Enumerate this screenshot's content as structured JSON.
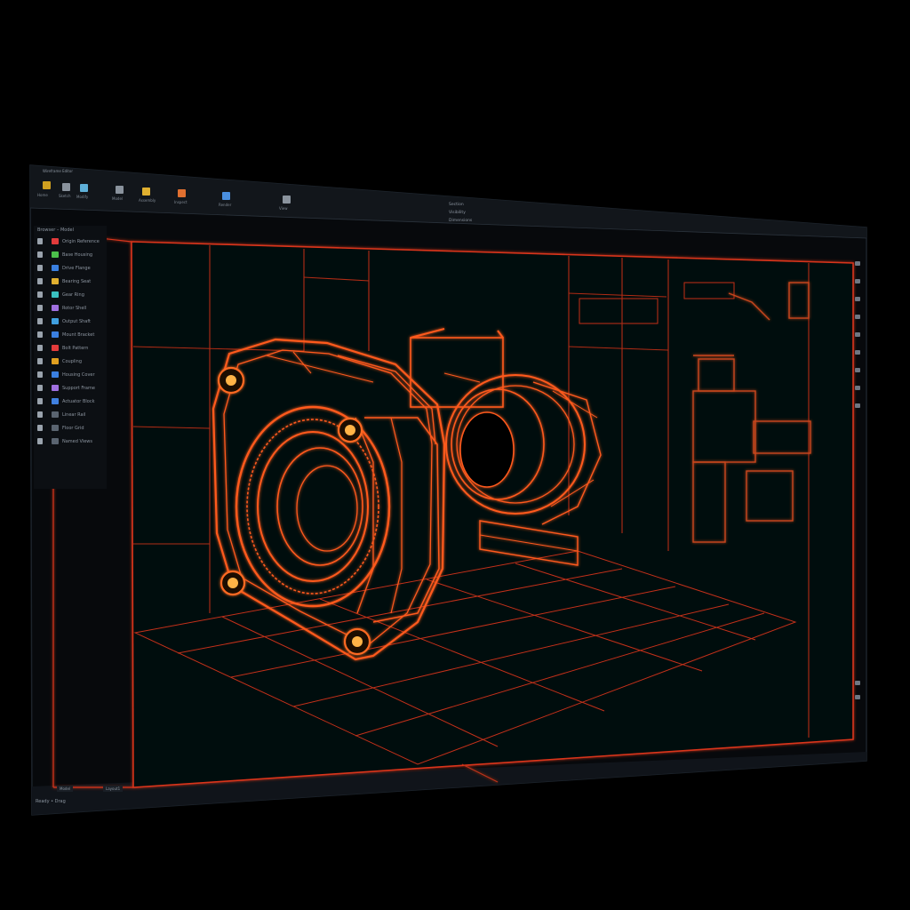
{
  "window": {
    "title_bar": "Wireframe Editor",
    "quick_access": [
      "•",
      "•",
      "•",
      "•",
      "•"
    ],
    "window_controls": [
      "—",
      "□",
      "✕"
    ]
  },
  "ribbon": {
    "groups": [
      {
        "label": "Home"
      },
      {
        "label": "Sketch"
      },
      {
        "label": "Modify"
      },
      {
        "label": "Model"
      },
      {
        "label": "Assembly"
      },
      {
        "label": "Inspect"
      },
      {
        "label": "Render"
      },
      {
        "label": "View"
      }
    ],
    "center_panel": [
      "Section",
      "Visibility",
      "Dimensions"
    ]
  },
  "browser": {
    "title": "Browser – Model",
    "items": [
      "Origin Reference",
      "Base Housing",
      "Drive Flange",
      "Bearing Seat",
      "Gear Ring",
      "Rotor Shell",
      "Output Shaft",
      "Mount Bracket",
      "Bolt Pattern",
      "Coupling",
      "Housing Cover",
      "Support Frame",
      "Actuator Block",
      "Linear Rail",
      "Floor Grid",
      "Named Views"
    ]
  },
  "tabs": [
    "Model",
    "Layout1"
  ],
  "status": {
    "text": "Ready  •  Drag"
  },
  "colors": {
    "accent": "#ff5a1f",
    "accent_bright": "#ff8a2a",
    "frame": "#d8361a",
    "background": "#07090c",
    "chrome": "#12161b"
  }
}
